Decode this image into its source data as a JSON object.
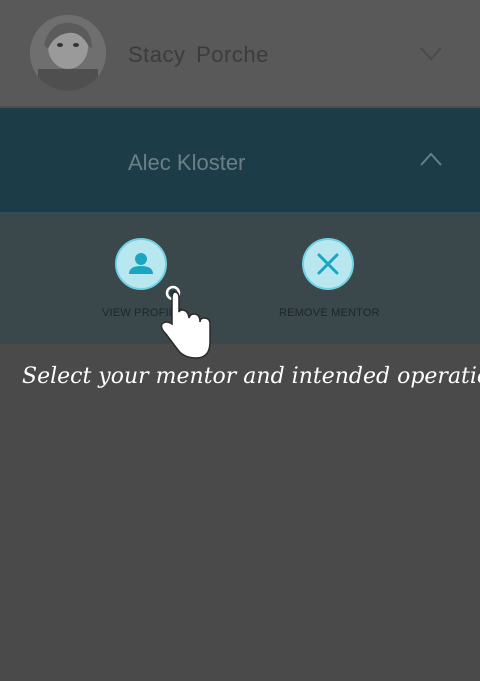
{
  "mentors": [
    {
      "name": "Stacy  Porche",
      "expanded": false
    },
    {
      "name": "Alec Kloster",
      "expanded": true
    }
  ],
  "actions": {
    "view_profile": "VIEW PROFILE",
    "remove_mentor": "REMOVE MENTOR"
  },
  "hint": "Select your mentor and intended operation",
  "colors": {
    "background": "#4a4a4a",
    "stacy_row": "#595959",
    "alec_row": "#1c3d47",
    "actions_panel": "#3a474b",
    "accent": "#6fd0e2",
    "icon": "#1aa6c0"
  }
}
